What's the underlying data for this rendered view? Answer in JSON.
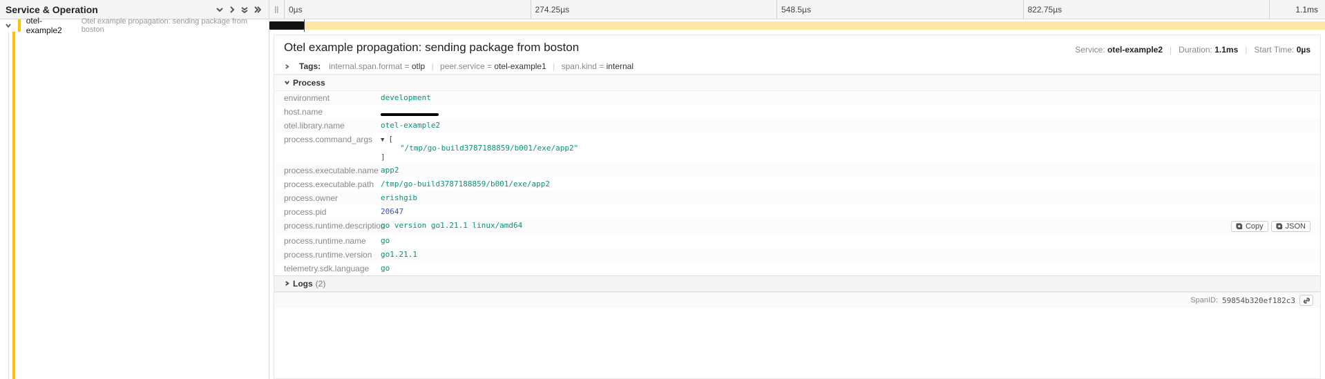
{
  "header": {
    "title": "Service & Operation",
    "ticks": [
      "0µs",
      "274.25µs",
      "548.5µs",
      "822.75µs"
    ],
    "total": "1.1ms"
  },
  "span_row": {
    "service": "otel-example2",
    "operation": "Otel example propagation: sending package from boston",
    "bar_left_pct": 0,
    "bar_width_pct": 3.3,
    "marker_pct": 3.3
  },
  "detail": {
    "title": "Otel example propagation: sending package from boston",
    "meta": {
      "service_label": "Service:",
      "service_value": "otel-example2",
      "duration_label": "Duration:",
      "duration_value": "1.1ms",
      "start_label": "Start Time:",
      "start_value": "0µs"
    },
    "tags": {
      "label": "Tags:",
      "items": [
        {
          "k": "internal.span.format",
          "v": "otlp"
        },
        {
          "k": "peer.service",
          "v": "otel-example1"
        },
        {
          "k": "span.kind",
          "v": "internal"
        }
      ]
    },
    "process": {
      "header": "Process",
      "rows": [
        {
          "key": "environment",
          "type": "str",
          "value": "development"
        },
        {
          "key": "host.name",
          "type": "redacted"
        },
        {
          "key": "otel.library.name",
          "type": "str",
          "value": "otel-example2"
        },
        {
          "key": "process.command_args",
          "type": "arr",
          "items": [
            "\"/tmp/go-build3787188859/b001/exe/app2\""
          ]
        },
        {
          "key": "process.executable.name",
          "type": "str",
          "value": "app2"
        },
        {
          "key": "process.executable.path",
          "type": "str",
          "value": "/tmp/go-build3787188859/b001/exe/app2"
        },
        {
          "key": "process.owner",
          "type": "str",
          "value": "erishgib"
        },
        {
          "key": "process.pid",
          "type": "num",
          "value": "20647"
        },
        {
          "key": "process.runtime.description",
          "type": "str",
          "value": "go version go1.21.1 linux/amd64",
          "actions": true
        },
        {
          "key": "process.runtime.name",
          "type": "str",
          "value": "go"
        },
        {
          "key": "process.runtime.version",
          "type": "str",
          "value": "go1.21.1"
        },
        {
          "key": "telemetry.sdk.language",
          "type": "str",
          "value": "go"
        }
      ],
      "copy_label": "Copy",
      "json_label": "JSON"
    },
    "logs": {
      "label": "Logs",
      "count": "(2)"
    },
    "footer": {
      "label": "SpanID:",
      "value": "59854b320ef182c3"
    }
  }
}
